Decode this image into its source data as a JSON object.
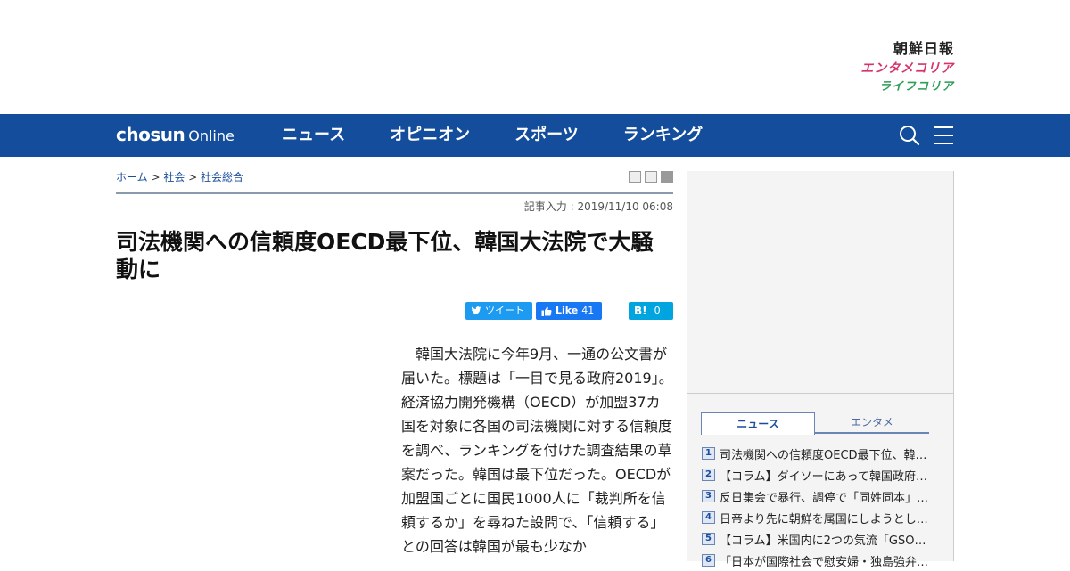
{
  "brands": {
    "chosun_ilbo": "朝鮮日報",
    "entame_korea": "エンタメコリア",
    "life_korea": "ライフコリア"
  },
  "nav": {
    "logo_main": "chosun",
    "logo_sub": "Online",
    "menu": [
      "ニュース",
      "オピニオン",
      "スポーツ",
      "ランキング"
    ],
    "icons": [
      "search-icon",
      "menu-icon"
    ],
    "color": "#134d9c"
  },
  "breadcrumb": {
    "home": "ホーム",
    "sep1": " > ",
    "section": "社会",
    "sep2": " > ",
    "subsection": "社会総合"
  },
  "article": {
    "dateline": "記事入力 : 2019/11/10 06:08",
    "headline": "司法機関への信頼度OECD最下位、韓国大法院で大騒動に",
    "share": {
      "tweet_label": "ツイート",
      "like_label": "Like",
      "like_count": "41",
      "hatena_count": "0"
    },
    "body": "　韓国大法院に今年9月、一通の公文書が届いた。標題は「一目で見る政府2019」。経済協力開発機構（OECD）が加盟37カ国を対象に各国の司法機関に対する信頼度を調べ、ランキングを付けた調査結果の草案だった。韓国は最下位だった。OECDが加盟国ごとに国民1000人に「裁判所を信頼するか」を尋ねた設問で、「信頼する」との回答は韓国が最も少なか"
  },
  "sidebar": {
    "tabs": [
      {
        "label": "ニュース",
        "active": true
      },
      {
        "label": "エンタメ",
        "active": false
      }
    ],
    "ranking": [
      {
        "num": "1",
        "title": "司法機関への信頼度OECD最下位、韓…"
      },
      {
        "num": "2",
        "title": "【コラム】ダイソーにあって韓国政府…"
      },
      {
        "num": "3",
        "title": "反日集会で暴行、調停で「同姓同本」…"
      },
      {
        "num": "4",
        "title": "日帝より先に朝鮮を属国にしようとし…"
      },
      {
        "num": "5",
        "title": "【コラム】米国内に2つの気流「GSO…"
      },
      {
        "num": "6",
        "title": "「日本が国際社会で慰安婦・独島強弁…"
      }
    ]
  }
}
